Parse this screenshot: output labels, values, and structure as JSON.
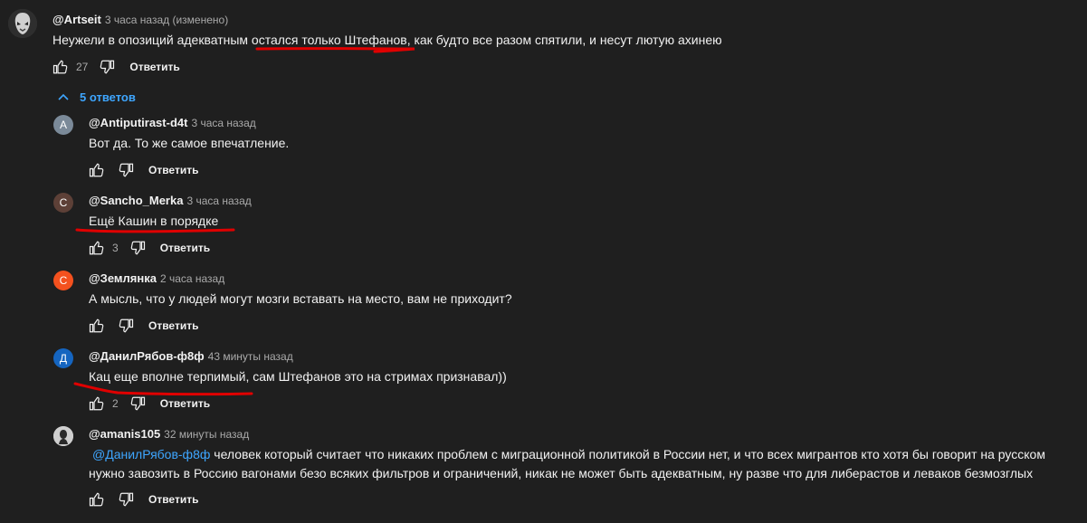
{
  "colors": {
    "background": "#1f1f1f",
    "text": "#f1f1f1",
    "secondary": "#aaaaaa",
    "link": "#3ea6ff",
    "annotation": "#e00000"
  },
  "icons": {
    "like": "thumb-up-icon",
    "dislike": "thumb-down-icon",
    "collapse": "chevron-up-icon"
  },
  "main_comment": {
    "author": "@Artseit",
    "time": "3 часа назад (изменено)",
    "text_before": "Неужели в опозиций адекватным ",
    "text_highlight": "остался только Штефанов",
    "text_after": ", как будто  все разом спятили, и несут лютую ахинею",
    "likes": "27",
    "reply_label": "Ответить"
  },
  "replies_toggle": "5 ответов",
  "replies": [
    {
      "avatar_letter": "A",
      "avatar_color": "#7b8a99",
      "author": "@Antiputirast-d4t",
      "time": "3 часа назад",
      "text": "Вот да. То же самое впечатление.",
      "likes": "",
      "reply_label": "Ответить"
    },
    {
      "avatar_letter": "С",
      "avatar_color": "#5d4037",
      "author": "@Sancho_Merka",
      "time": "3 часа назад",
      "text": "Ещё Кашин в порядке",
      "likes": "3",
      "reply_label": "Ответить"
    },
    {
      "avatar_letter": "С",
      "avatar_color": "#f4511e",
      "author": "@Землянка",
      "time": "2 часа назад",
      "text": "А мысль, что у людей могут мозги вставать на место, вам не приходит?",
      "likes": "",
      "reply_label": "Ответить"
    },
    {
      "avatar_letter": "Д",
      "avatar_color": "#1565c0",
      "author": "@ДанилРябов-ф8ф",
      "time": "43 минуты назад",
      "text": "Кац еще вполне терпимый, сам Штефанов это на стримах признавал))",
      "likes": "2",
      "reply_label": "Ответить"
    },
    {
      "avatar_letter": "",
      "avatar_color": "#d9d9d9",
      "author": "@amanis105",
      "time": "32 минуты назад",
      "mention": "@ДанилРябов-ф8ф",
      "text_line1": " человек который считает что никаких проблем с миграционной политикой в России нет, и что всех мигрантов кто хотя бы говорит на русском",
      "text_line2": "нужно завозить в Россию вагонами безо всяких фильтров и ограничений, никак не может быть адекватным, ну разве что для либерастов и леваков безмозглых",
      "likes": "",
      "reply_label": "Ответить"
    }
  ]
}
